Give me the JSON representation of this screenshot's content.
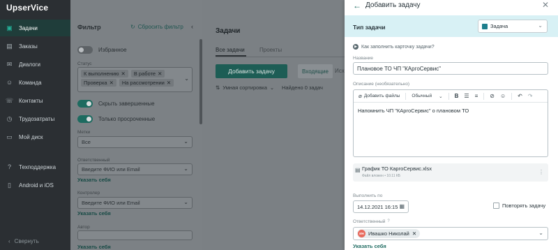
{
  "nav": {
    "logo": "UpserVice",
    "items": [
      {
        "label": "Задачи",
        "icon": "tasks-icon"
      },
      {
        "label": "Заказы",
        "icon": "orders-icon"
      },
      {
        "label": "Диалоги",
        "icon": "dialogs-icon"
      },
      {
        "label": "Команда",
        "icon": "team-icon"
      },
      {
        "label": "Контакты",
        "icon": "contacts-icon"
      },
      {
        "label": "Трудозатраты",
        "icon": "timecost-icon"
      },
      {
        "label": "Мой диск",
        "icon": "disk-icon"
      },
      {
        "label": "Техподдержка",
        "icon": "support-icon"
      },
      {
        "label": "Android и iOS",
        "icon": "mobile-icon"
      }
    ],
    "collapse_label": "Свернуть"
  },
  "filter": {
    "title": "Фильтр",
    "reset_label": "Сбросить фильтр",
    "favorites_label": "Избранное",
    "status_label": "Статус",
    "status_chips": [
      "К выполнению",
      "В работе",
      "Проверка",
      "На рассмотрении"
    ],
    "hide_completed_label": "Скрыть завершенные",
    "only_overdue_label": "Только просроченные",
    "tags_label": "Метки",
    "tags_value": "Все",
    "responsible_label": "Ответственный",
    "responsible_placeholder": "Введите ФИО или Email",
    "responsible_link": "Указать себя",
    "controller_label": "Контролер",
    "controller_placeholder": "Введите ФИО или Email",
    "controller_link": "Указать себя",
    "author_label": "Автор",
    "author_link": "Указать себя"
  },
  "main": {
    "title": "Задачи",
    "tabs": [
      "Все задачи",
      "Проекты"
    ],
    "add_button": "Добавить задачу",
    "incoming": "Входящие",
    "outgoing_partial": "Исх",
    "sort_label": "Умная сортировка",
    "found_label": "Найдено 0 задач"
  },
  "dialog": {
    "title": "Добавить задачу",
    "task_type_label": "Тип задачи",
    "task_type_value": "Задача",
    "howto_label": "Как заполнить карточку задачи?",
    "name_label": "Название",
    "name_value": "Плановое ТО ЧП \"КАргоСервис\"",
    "desc_label": "Описание (необязательно)",
    "toolbar": {
      "attach": "Добавить файлы",
      "style": "Обычный"
    },
    "desc_value": "Напомнить ЧП \"КАргоСервис\" о плановом ТО",
    "file": {
      "name": "График ТО КаргоСервис.xlsx",
      "meta": "Файл вложен • 10.11 КБ"
    },
    "due_label": "Выполнить по",
    "due_value": "14.12.2021 16:15",
    "repeat_label": "Повторять задачу",
    "responsible_label": "Ответственный",
    "responsible_name": "Ивашко Николай",
    "responsible_initials": "ИН",
    "responsible_link": "Указать себя"
  }
}
